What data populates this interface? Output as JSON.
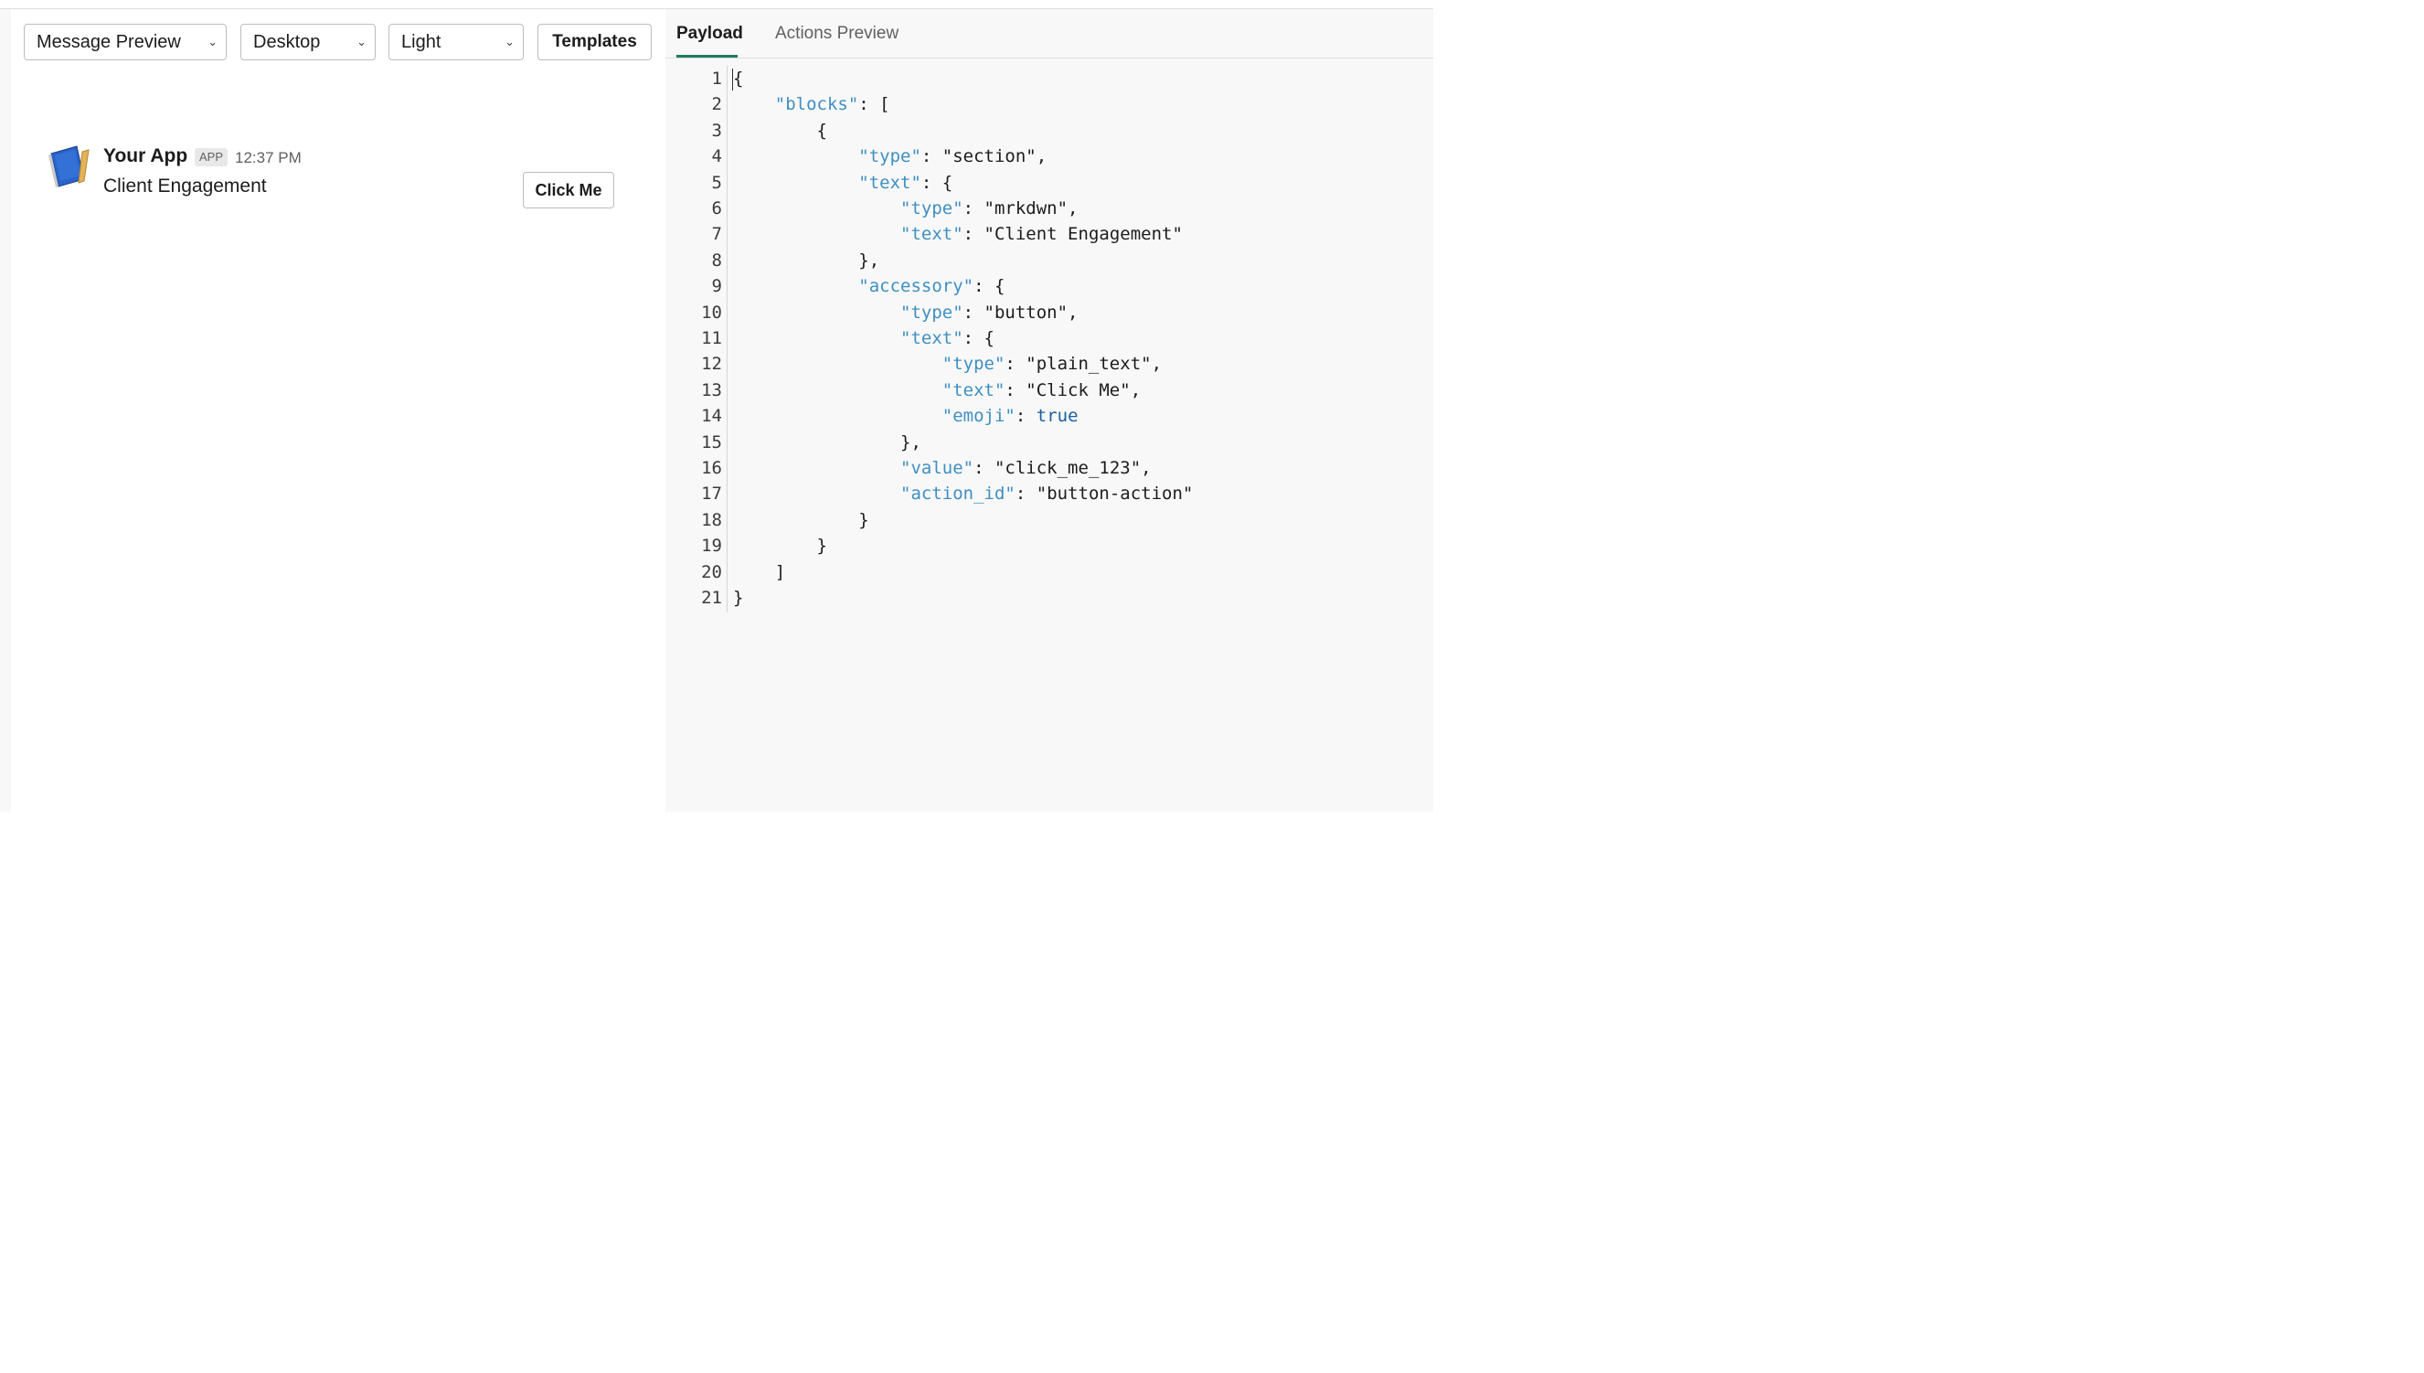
{
  "toolbar": {
    "preview_mode": "Message Preview",
    "device": "Desktop",
    "theme": "Light",
    "templates_label": "Templates"
  },
  "message": {
    "app_name": "Your App",
    "badge": "APP",
    "time": "12:37 PM",
    "text": "Client Engagement",
    "button_label": "Click Me"
  },
  "tabs": {
    "payload": "Payload",
    "actions": "Actions Preview"
  },
  "colors": {
    "key": "#3f8fc2",
    "boolean": "#1a5fa0",
    "tab_accent": "#1d7a5f"
  },
  "code_lines": [
    [
      [
        "p",
        "{"
      ]
    ],
    [
      [
        "p",
        "    "
      ],
      [
        "k",
        "\"blocks\""
      ],
      [
        "p",
        ": ["
      ]
    ],
    [
      [
        "p",
        "        {"
      ]
    ],
    [
      [
        "p",
        "            "
      ],
      [
        "k",
        "\"type\""
      ],
      [
        "p",
        ": \"section\","
      ]
    ],
    [
      [
        "p",
        "            "
      ],
      [
        "k",
        "\"text\""
      ],
      [
        "p",
        ": {"
      ]
    ],
    [
      [
        "p",
        "                "
      ],
      [
        "k",
        "\"type\""
      ],
      [
        "p",
        ": \"mrkdwn\","
      ]
    ],
    [
      [
        "p",
        "                "
      ],
      [
        "k",
        "\"text\""
      ],
      [
        "p",
        ": \"Client Engagement\""
      ]
    ],
    [
      [
        "p",
        "            },"
      ]
    ],
    [
      [
        "p",
        "            "
      ],
      [
        "k",
        "\"accessory\""
      ],
      [
        "p",
        ": {"
      ]
    ],
    [
      [
        "p",
        "                "
      ],
      [
        "k",
        "\"type\""
      ],
      [
        "p",
        ": \"button\","
      ]
    ],
    [
      [
        "p",
        "                "
      ],
      [
        "k",
        "\"text\""
      ],
      [
        "p",
        ": {"
      ]
    ],
    [
      [
        "p",
        "                    "
      ],
      [
        "k",
        "\"type\""
      ],
      [
        "p",
        ": \"plain_text\","
      ]
    ],
    [
      [
        "p",
        "                    "
      ],
      [
        "k",
        "\"text\""
      ],
      [
        "p",
        ": \"Click Me\","
      ]
    ],
    [
      [
        "p",
        "                    "
      ],
      [
        "k",
        "\"emoji\""
      ],
      [
        "p",
        ": "
      ],
      [
        "b",
        "true"
      ]
    ],
    [
      [
        "p",
        "                },"
      ]
    ],
    [
      [
        "p",
        "                "
      ],
      [
        "k",
        "\"value\""
      ],
      [
        "p",
        ": \"click_me_123\","
      ]
    ],
    [
      [
        "p",
        "                "
      ],
      [
        "k",
        "\"action_id\""
      ],
      [
        "p",
        ": \"button-action\""
      ]
    ],
    [
      [
        "p",
        "            }"
      ]
    ],
    [
      [
        "p",
        "        }"
      ]
    ],
    [
      [
        "p",
        "    ]"
      ]
    ],
    [
      [
        "p",
        "}"
      ]
    ]
  ]
}
